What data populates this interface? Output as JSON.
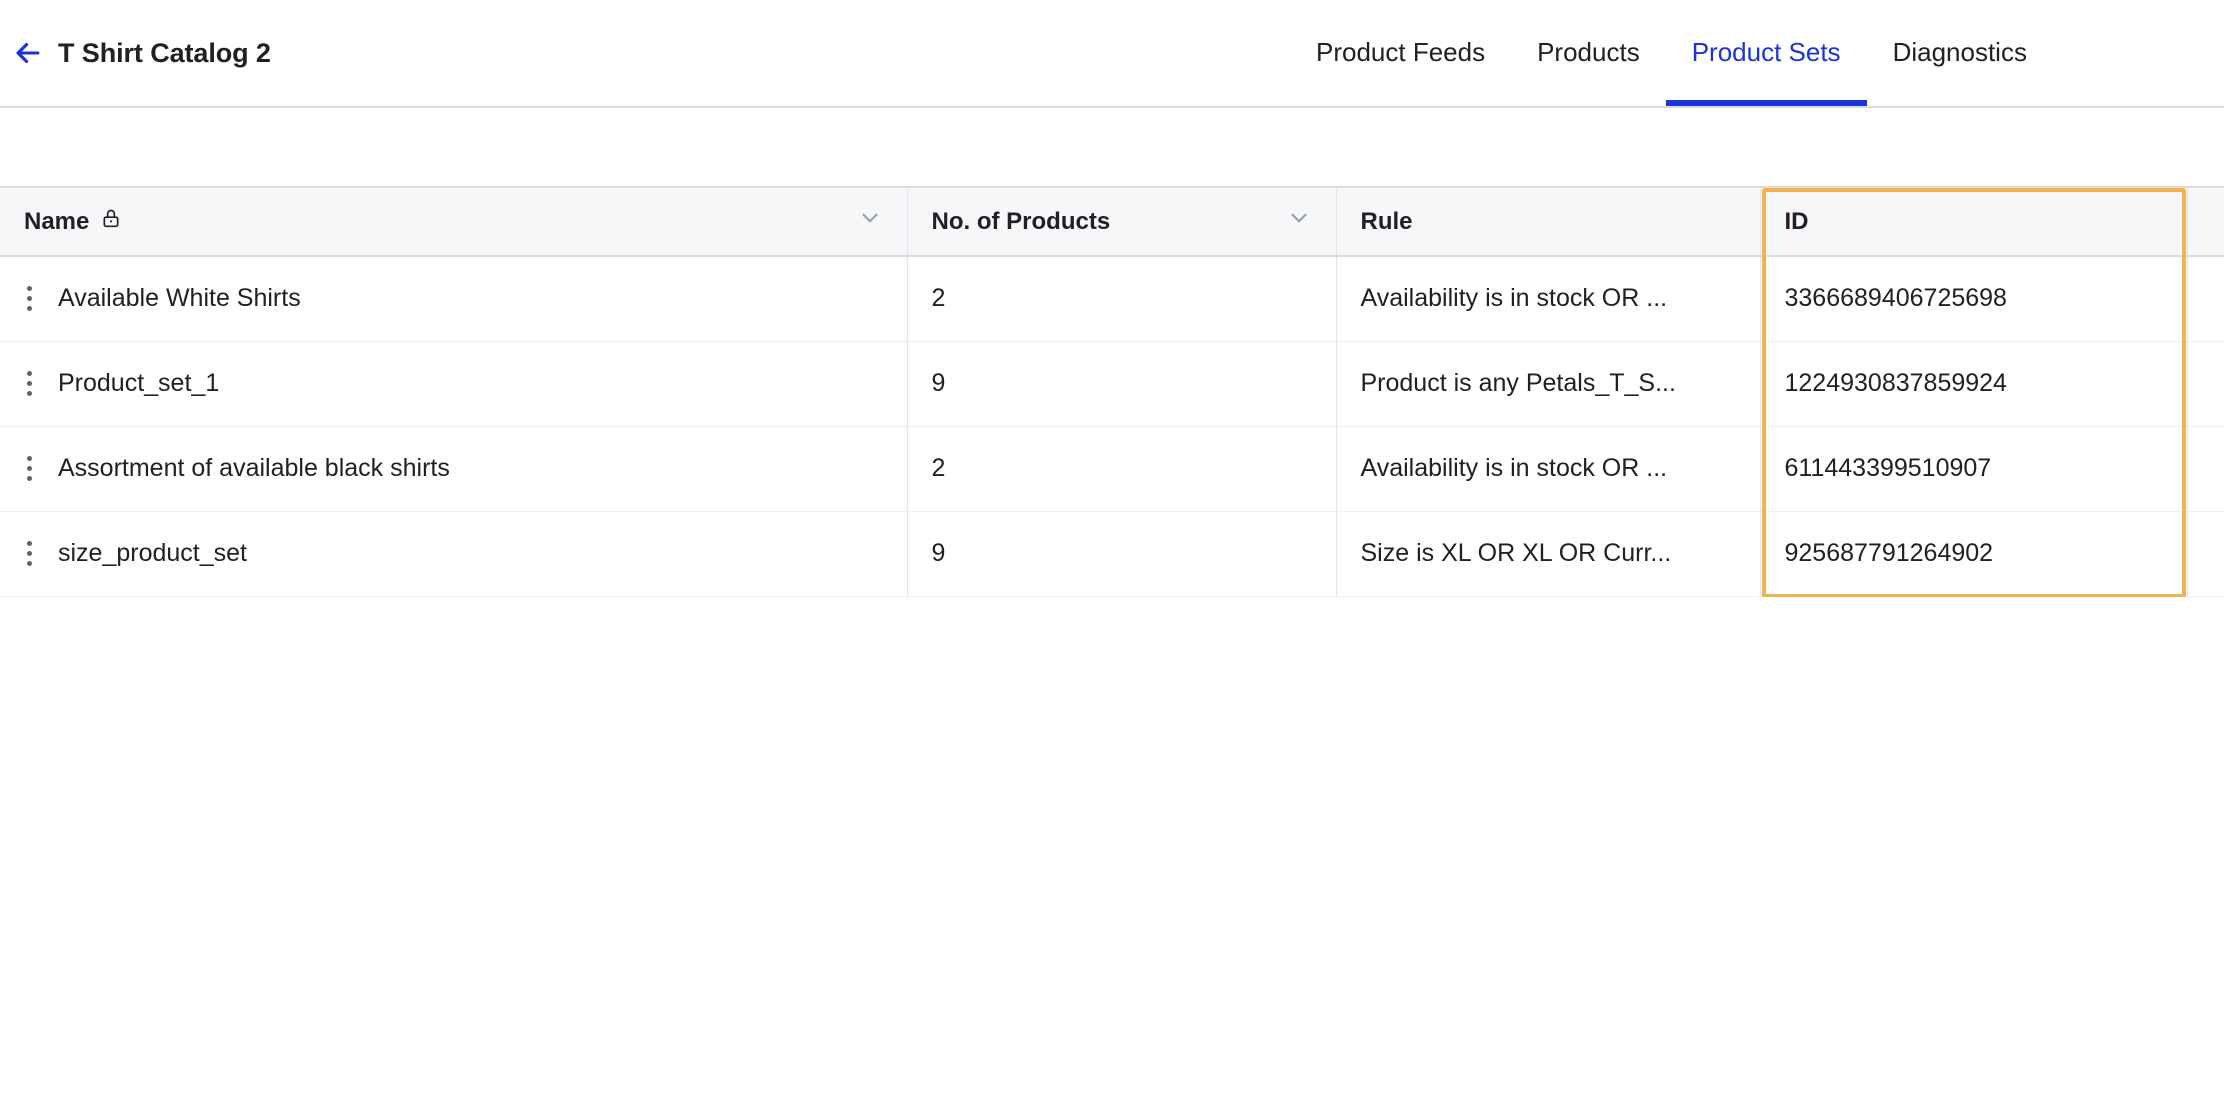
{
  "header": {
    "back_icon": "arrow-left-icon",
    "title": "T Shirt Catalog 2",
    "accent_blue": "#1A34D8"
  },
  "tabs": [
    {
      "label": "Product Feeds",
      "active": false
    },
    {
      "label": "Products",
      "active": false
    },
    {
      "label": "Product Sets",
      "active": true
    },
    {
      "label": "Diagnostics",
      "active": false
    }
  ],
  "table": {
    "columns": [
      {
        "label": "Name",
        "lock_icon": "lock-icon",
        "sort_icon": "chevron-down-icon"
      },
      {
        "label": "No. of Products",
        "lock_icon": null,
        "sort_icon": "chevron-down-icon"
      },
      {
        "label": "Rule",
        "lock_icon": null,
        "sort_icon": null
      },
      {
        "label": "ID",
        "lock_icon": null,
        "sort_icon": null
      },
      {
        "label": "",
        "lock_icon": null,
        "sort_icon": null
      }
    ],
    "rows": [
      {
        "menu_icon": "kebab-menu-icon",
        "name": "Available White Shirts",
        "products": "2",
        "rule": "Availability is in stock OR ...",
        "id": "3366689406725698"
      },
      {
        "menu_icon": "kebab-menu-icon",
        "name": "Product_set_1",
        "products": "9",
        "rule": "Product is any Petals_T_S...",
        "id": "1224930837859924"
      },
      {
        "menu_icon": "kebab-menu-icon",
        "name": "Assortment of available black shirts",
        "products": "2",
        "rule": "Availability is in stock OR ...",
        "id": "611443399510907"
      },
      {
        "menu_icon": "kebab-menu-icon",
        "name": "size_product_set",
        "products": "9",
        "rule": "Size is XL OR XL OR Curr...",
        "id": "925687791264902"
      }
    ],
    "highlight": {
      "column": "ID",
      "color": "#F2B24E"
    }
  }
}
